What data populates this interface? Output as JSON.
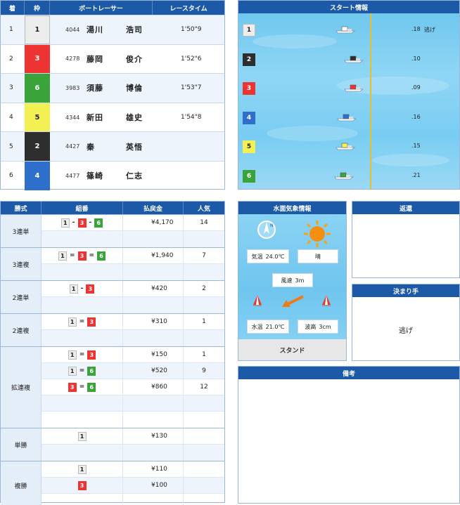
{
  "results": {
    "headers": {
      "pos": "着",
      "waku": "枠",
      "racer": "ボートレーサー",
      "time": "レースタイム"
    },
    "rows": [
      {
        "pos": "1",
        "waku": "1",
        "no": "4044",
        "sei": "湯川",
        "mei": "浩司",
        "time": "1'50\"9"
      },
      {
        "pos": "2",
        "waku": "3",
        "no": "4278",
        "sei": "藤岡",
        "mei": "俊介",
        "time": "1'52\"6"
      },
      {
        "pos": "3",
        "waku": "6",
        "no": "3983",
        "sei": "須藤",
        "mei": "博倫",
        "time": "1'53\"7"
      },
      {
        "pos": "4",
        "waku": "5",
        "no": "4344",
        "sei": "新田",
        "mei": "雄史",
        "time": "1'54\"8"
      },
      {
        "pos": "5",
        "waku": "2",
        "no": "4427",
        "sei": "秦",
        "mei": "英悟",
        "time": ""
      },
      {
        "pos": "6",
        "waku": "4",
        "no": "4477",
        "sei": "篠崎",
        "mei": "仁志",
        "time": ""
      }
    ]
  },
  "start_info": {
    "title": "スタート情報",
    "rows": [
      {
        "lane": "1",
        "st": ".18",
        "note": "逃げ"
      },
      {
        "lane": "2",
        "st": ".10",
        "note": ""
      },
      {
        "lane": "3",
        "st": ".09",
        "note": ""
      },
      {
        "lane": "4",
        "st": ".16",
        "note": ""
      },
      {
        "lane": "5",
        "st": ".15",
        "note": ""
      },
      {
        "lane": "6",
        "st": ".21",
        "note": ""
      }
    ]
  },
  "payout": {
    "headers": {
      "type": "勝式",
      "combo": "組番",
      "amount": "払戻金",
      "pop": "人気"
    },
    "groups": [
      {
        "type": "3連単",
        "lines": [
          {
            "combo": [
              "1",
              "-",
              "3",
              "-",
              "6"
            ],
            "amount": "¥4,170",
            "pop": "14"
          },
          {
            "combo": [],
            "amount": "",
            "pop": ""
          }
        ]
      },
      {
        "type": "3連複",
        "lines": [
          {
            "combo": [
              "1",
              "=",
              "3",
              "=",
              "6"
            ],
            "amount": "¥1,940",
            "pop": "7"
          },
          {
            "combo": [],
            "amount": "",
            "pop": ""
          }
        ]
      },
      {
        "type": "2連単",
        "lines": [
          {
            "combo": [
              "1",
              "-",
              "3"
            ],
            "amount": "¥420",
            "pop": "2"
          },
          {
            "combo": [],
            "amount": "",
            "pop": ""
          }
        ]
      },
      {
        "type": "2連複",
        "lines": [
          {
            "combo": [
              "1",
              "=",
              "3"
            ],
            "amount": "¥310",
            "pop": "1"
          },
          {
            "combo": [],
            "amount": "",
            "pop": ""
          }
        ]
      },
      {
        "type": "拡連複",
        "lines": [
          {
            "combo": [
              "1",
              "=",
              "3"
            ],
            "amount": "¥150",
            "pop": "1"
          },
          {
            "combo": [
              "1",
              "=",
              "6"
            ],
            "amount": "¥520",
            "pop": "9"
          },
          {
            "combo": [
              "3",
              "=",
              "6"
            ],
            "amount": "¥860",
            "pop": "12"
          },
          {
            "combo": [],
            "amount": "",
            "pop": ""
          },
          {
            "combo": [],
            "amount": "",
            "pop": ""
          }
        ]
      },
      {
        "type": "単勝",
        "lines": [
          {
            "combo": [
              "1"
            ],
            "amount": "¥130",
            "pop": ""
          },
          {
            "combo": [],
            "amount": "",
            "pop": ""
          }
        ]
      },
      {
        "type": "複勝",
        "lines": [
          {
            "combo": [
              "1"
            ],
            "amount": "¥110",
            "pop": ""
          },
          {
            "combo": [
              "3"
            ],
            "amount": "¥100",
            "pop": ""
          },
          {
            "combo": [],
            "amount": "",
            "pop": ""
          }
        ]
      }
    ]
  },
  "weather": {
    "title": "水面気象情報",
    "temp_label": "気温",
    "temp": "24.0℃",
    "weather": "晴",
    "wind_label": "風速",
    "wind": "3m",
    "water_label": "水温",
    "water": "21.0℃",
    "wave_label": "波高",
    "wave": "3cm",
    "stand": "スタンド"
  },
  "henkan": {
    "title": "返還"
  },
  "kimarite": {
    "title": "決まり手",
    "value": "逃げ"
  },
  "biko": {
    "title": "備考"
  },
  "colors": {
    "header": "#1c5aa8",
    "w1": "#ededed",
    "w2": "#2e2e2e",
    "w3": "#ee3333",
    "w4": "#2f6fcc",
    "w5": "#f2f052",
    "w6": "#3aa43a"
  }
}
